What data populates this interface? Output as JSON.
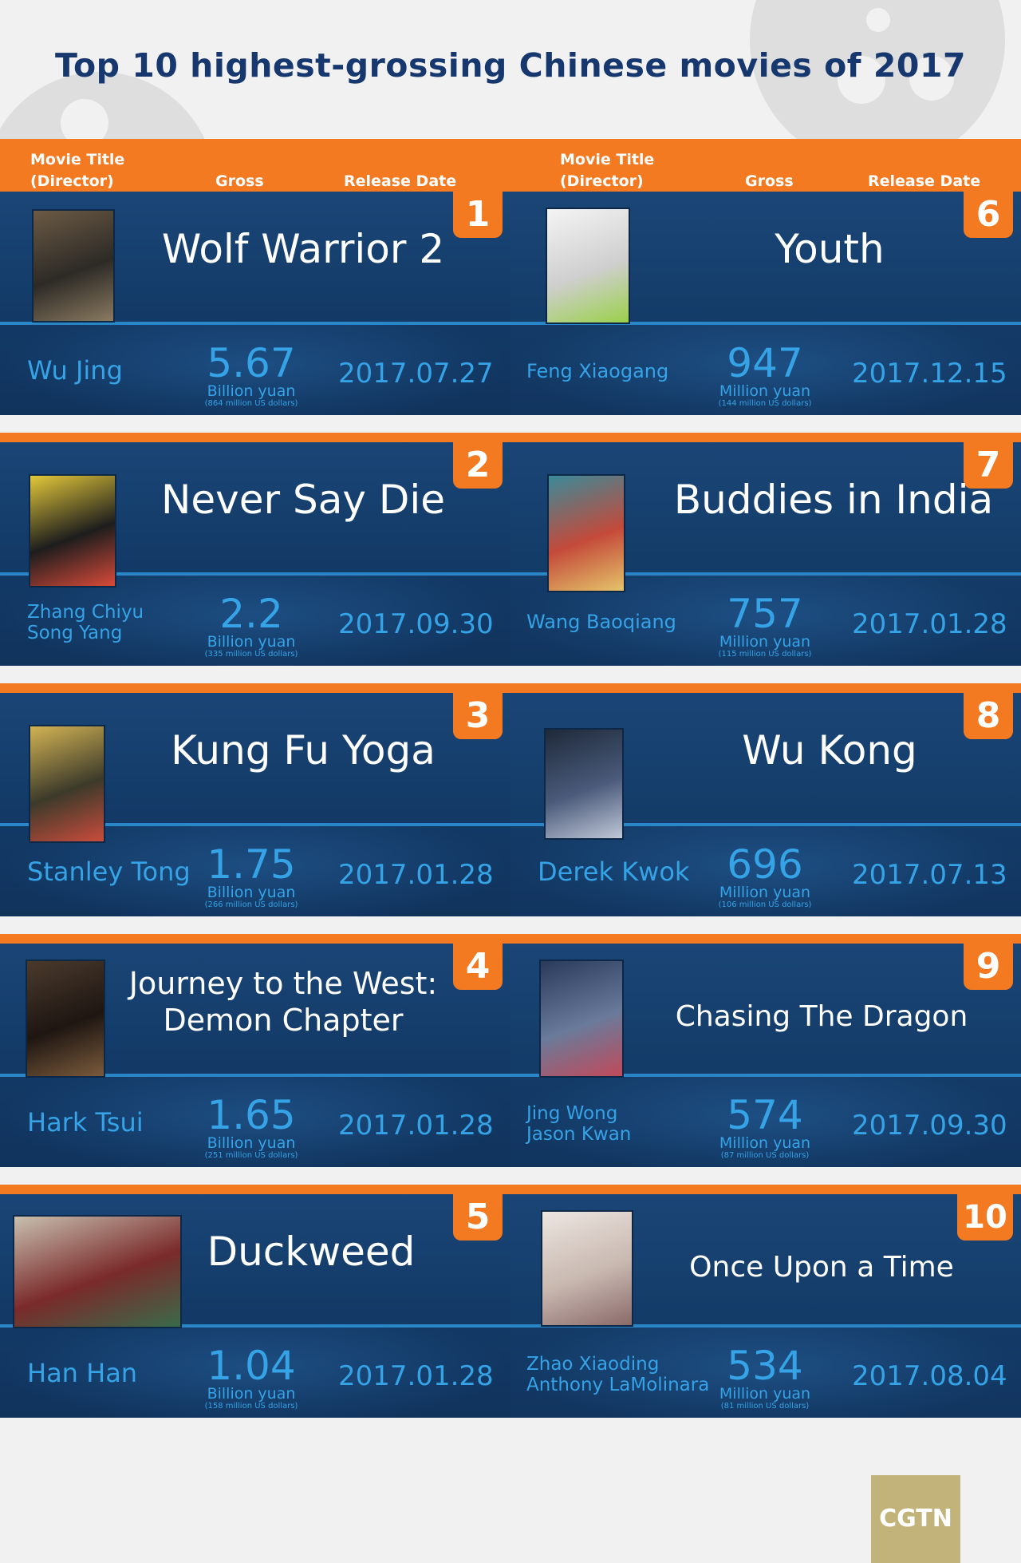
{
  "title": "Top 10 highest-grossing Chinese movies of 2017",
  "header": {
    "left": {
      "movie_title": "Movie Title",
      "director": "(Director)",
      "gross": "Gross",
      "release_date": "Release Date"
    },
    "right": {
      "movie_title": "Movie Title",
      "director": "(Director)",
      "gross": "Gross",
      "release_date": "Release Date"
    }
  },
  "colors": {
    "orange": "#f47a22",
    "navy": "#16386e",
    "card": "#143c69",
    "accent": "#35a3e6"
  },
  "chart_data": {
    "type": "table",
    "title": "Top 10 highest-grossing Chinese movies of 2017",
    "columns": [
      "Movie Title (Director)",
      "Gross",
      "Release Date"
    ],
    "rows": [
      {
        "rank": "1",
        "title": "Wolf Warrior 2",
        "director": [
          "Wu Jing"
        ],
        "gross": "5.67",
        "unit": "Billion yuan",
        "usd": "(864 million US dollars)",
        "date": "2017.07.27"
      },
      {
        "rank": "2",
        "title": "Never Say Die",
        "director": [
          "Zhang Chiyu",
          "Song Yang"
        ],
        "gross": "2.2",
        "unit": "Billion yuan",
        "usd": "(335 million US dollars)",
        "date": "2017.09.30"
      },
      {
        "rank": "3",
        "title": "Kung Fu Yoga",
        "director": [
          "Stanley Tong"
        ],
        "gross": "1.75",
        "unit": "Billion yuan",
        "usd": "(266 million US dollars)",
        "date": "2017.01.28"
      },
      {
        "rank": "4",
        "title": "Journey to the West: Demon Chapter",
        "director": [
          "Hark Tsui"
        ],
        "gross": "1.65",
        "unit": "Billion yuan",
        "usd": "(251 million US dollars)",
        "date": "2017.01.28"
      },
      {
        "rank": "5",
        "title": "Duckweed",
        "director": [
          "Han Han"
        ],
        "gross": "1.04",
        "unit": "Billion yuan",
        "usd": "(158 million US dollars)",
        "date": "2017.01.28"
      },
      {
        "rank": "6",
        "title": "Youth",
        "director": [
          "Feng Xiaogang"
        ],
        "gross": "947",
        "unit": "Million yuan",
        "usd": "(144 million US dollars)",
        "date": "2017.12.15"
      },
      {
        "rank": "7",
        "title": "Buddies in India",
        "director": [
          "Wang Baoqiang"
        ],
        "gross": "757",
        "unit": "Million yuan",
        "usd": "(115 million US dollars)",
        "date": "2017.01.28"
      },
      {
        "rank": "8",
        "title": "Wu Kong",
        "director": [
          "Derek Kwok"
        ],
        "gross": "696",
        "unit": "Million yuan",
        "usd": "(106 million US dollars)",
        "date": "2017.07.13"
      },
      {
        "rank": "9",
        "title": "Chasing The Dragon",
        "director": [
          "Jing Wong",
          "Jason Kwan"
        ],
        "gross": "574",
        "unit": "Million yuan",
        "usd": "(87 million US dollars)",
        "date": "2017.09.30"
      },
      {
        "rank": "10",
        "title": "Once Upon a Time",
        "director": [
          "Zhao Xiaoding",
          "Anthony LaMolinara"
        ],
        "gross": "534",
        "unit": "Million yuan",
        "usd": "(81 million US dollars)",
        "date": "2017.08.04"
      }
    ]
  },
  "logo": "CGTN"
}
